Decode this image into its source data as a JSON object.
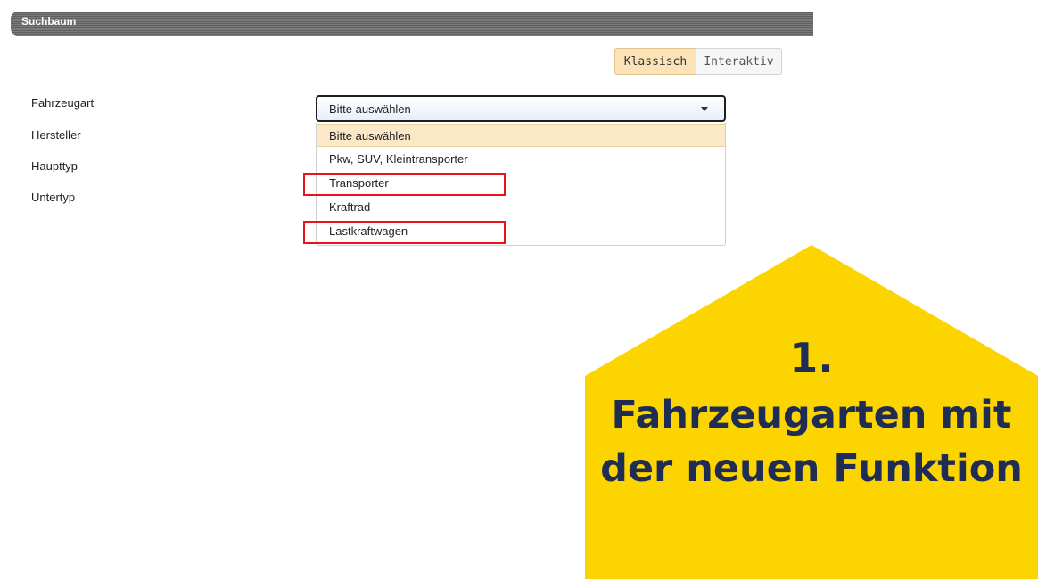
{
  "panel": {
    "title": "Suchbaum"
  },
  "view_toggle": {
    "active_label": "Klassisch",
    "inactive_label": "Interaktiv"
  },
  "form": {
    "labels": [
      "Fahrzeugart",
      "Hersteller",
      "Haupttyp",
      "Untertyp"
    ],
    "select_value": "Bitte auswählen",
    "options": [
      "Bitte auswählen",
      "Pkw, SUV, Kleintransporter",
      "Transporter",
      "Kraftrad",
      "Lastkraftwagen"
    ]
  },
  "callout": {
    "number": "1.",
    "line1": "Fahrzeugarten mit",
    "line2": "der neuen Funktion",
    "color": "#fcd400",
    "text_color": "#1f2d55"
  },
  "highlight_color": "#e8141b"
}
